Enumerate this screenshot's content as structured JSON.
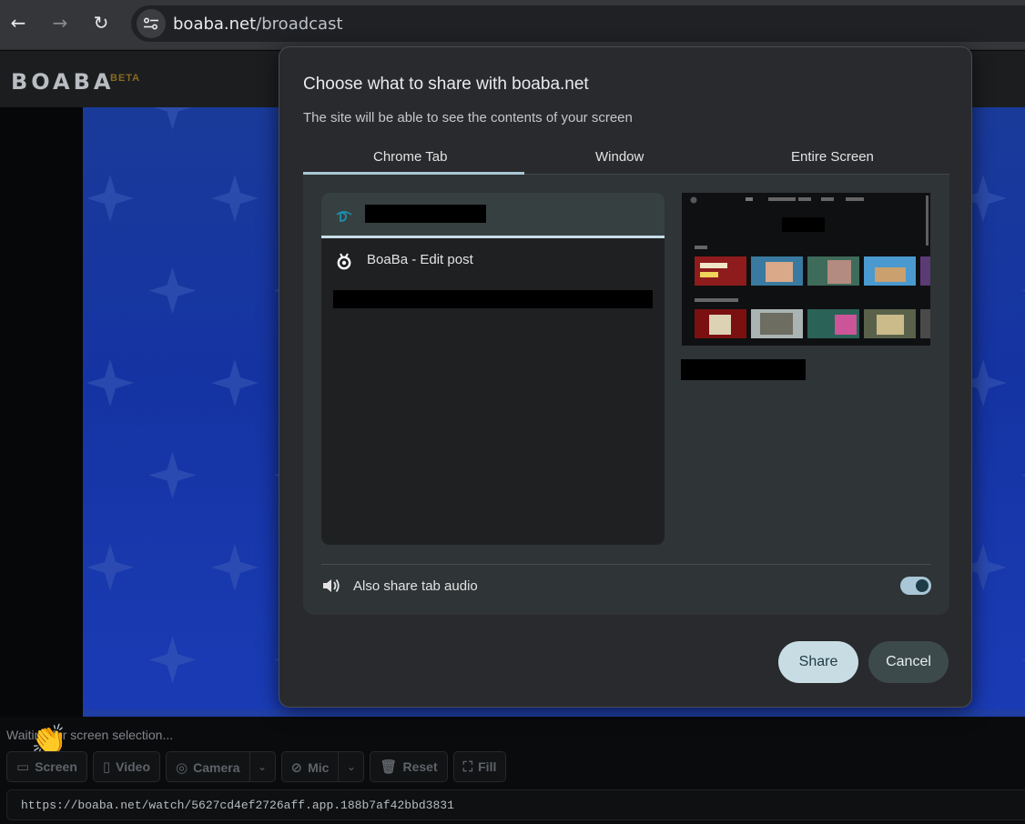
{
  "browser": {
    "back_icon": "arrow-left-icon",
    "forward_icon": "arrow-right-icon",
    "reload_icon": "reload-icon",
    "url_host": "boaba.net",
    "url_path": "/broadcast"
  },
  "app": {
    "logo": "BOABA",
    "beta": "BETA"
  },
  "dialog": {
    "title": "Choose what to share with boaba.net",
    "subtitle": "The site will be able to see the contents of your screen",
    "tabs": [
      {
        "label": "Chrome Tab",
        "selected": true
      },
      {
        "label": "Window",
        "selected": false
      },
      {
        "label": "Entire Screen",
        "selected": false
      }
    ],
    "tab_items": [
      {
        "title": "",
        "redacted": true,
        "selected": true
      },
      {
        "title": "BoaBa - Edit post",
        "selected": false
      },
      {
        "title": "",
        "redacted": true,
        "selected": false
      }
    ],
    "audio_label": "Also share tab audio",
    "audio_enabled": true,
    "share_label": "Share",
    "cancel_label": "Cancel",
    "accent_color": "#a9c7d6"
  },
  "controls": {
    "status": "Waiting for screen selection...",
    "buttons": [
      {
        "label": "Screen",
        "icon": "monitor-icon"
      },
      {
        "label": "Video",
        "icon": "file-icon"
      },
      {
        "label": "Camera",
        "icon": "camera-icon"
      },
      {
        "label": "Mic",
        "icon": "mic-off-icon"
      },
      {
        "label": "Reset",
        "icon": "trash-icon"
      },
      {
        "label": "Fill",
        "icon": "expand-icon"
      }
    ],
    "watch_url": "https://boaba.net/watch/5627cd4ef2726aff.app.188b7af42bbd3831"
  }
}
